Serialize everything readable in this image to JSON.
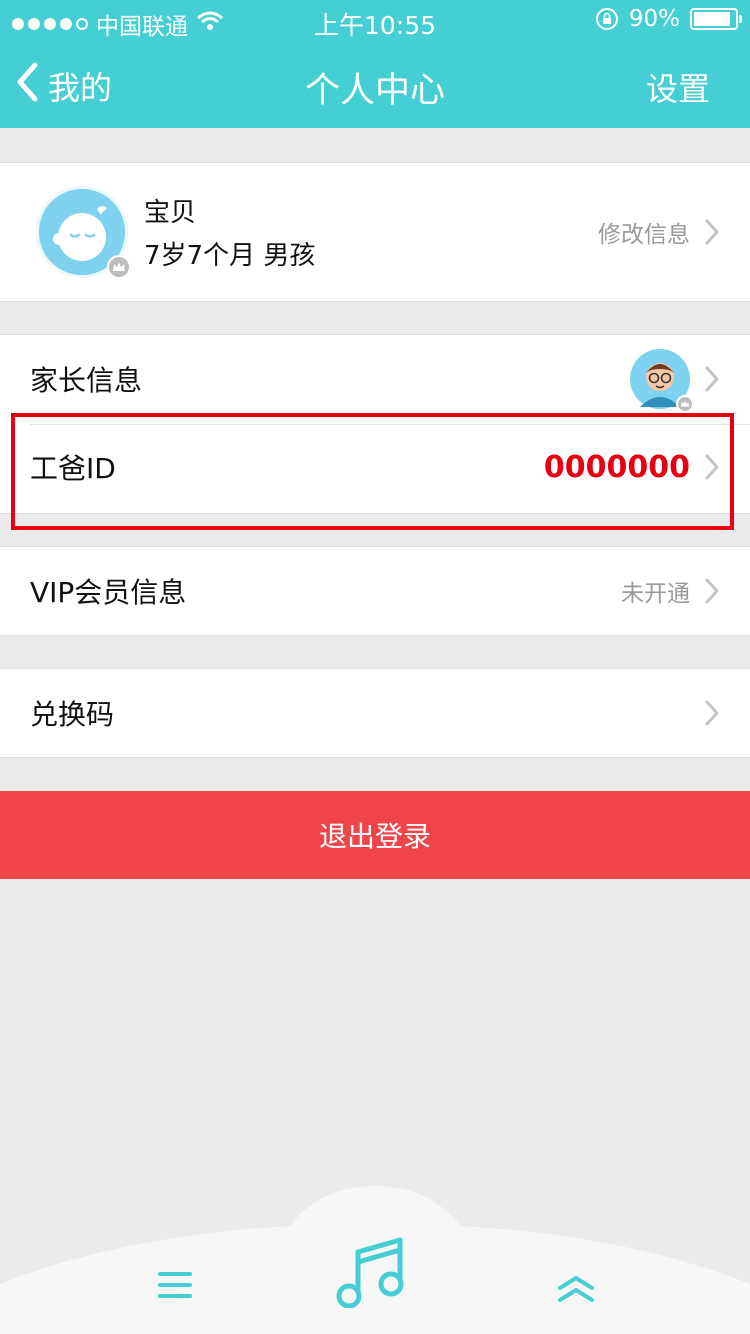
{
  "status_bar": {
    "carrier": "中国联通",
    "time": "上午10:55",
    "battery": "90%",
    "battery_level": 0.9
  },
  "navbar": {
    "back_label": "我的",
    "title": "个人中心",
    "settings_label": "设置"
  },
  "profile": {
    "name": "宝贝",
    "details": "7岁7个月 男孩",
    "edit_label": "修改信息"
  },
  "parent_info": {
    "label": "家长信息"
  },
  "gongba_id": {
    "label": "工爸ID",
    "value": "0000000"
  },
  "vip": {
    "label": "VIP会员信息",
    "status": "未开通"
  },
  "redeem": {
    "label": "兑换码"
  },
  "logout": {
    "label": "退出登录"
  },
  "colors": {
    "header": "#45cfd5",
    "highlight": "#e60012",
    "logout": "#f04548",
    "accent_icon": "#45cfd5"
  }
}
